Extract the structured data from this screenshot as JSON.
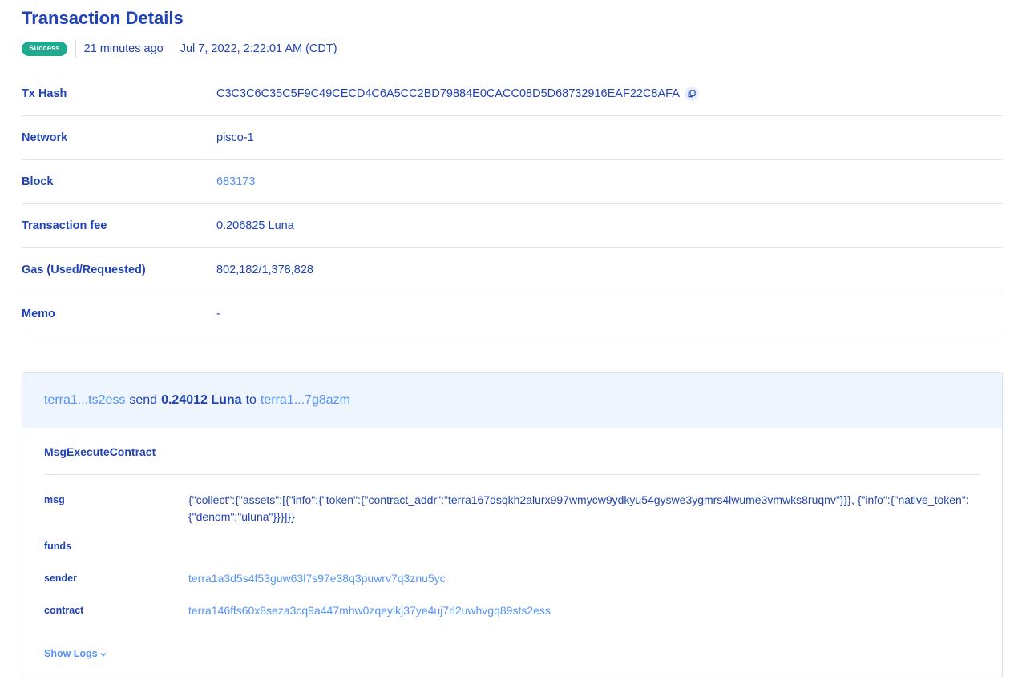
{
  "page": {
    "title": "Transaction Details"
  },
  "status": {
    "badge": "Success",
    "relative_time": "21 minutes ago",
    "timestamp": "Jul 7, 2022, 2:22:01 AM (CDT)"
  },
  "details": [
    {
      "label": "Tx Hash",
      "value": "C3C3C6C35C5F9C49CECD4C6A5CC2BD79884E0CACC08D5D68732916EAF22C8AFA"
    },
    {
      "label": "Network",
      "value": "pisco-1"
    },
    {
      "label": "Block",
      "value": "683173"
    },
    {
      "label": "Transaction fee",
      "value": "0.206825 Luna"
    },
    {
      "label": "Gas (Used/Requested)",
      "value": "802,182/1,378,828"
    },
    {
      "label": "Memo",
      "value": "-"
    }
  ],
  "message": {
    "summary": {
      "from": "terra1...ts2ess",
      "action": "send",
      "amount": "0.24012 Luna",
      "to_word": "to",
      "to": "terra1...7g8azm"
    },
    "type": "MsgExecuteContract",
    "params": [
      {
        "label": "msg",
        "value": "{\"collect\":{\"assets\":[{\"info\":{\"token\":{\"contract_addr\":\"terra167dsqkh2alurx997wmycw9ydkyu54gyswe3ygmrs4lwume3vmwks8ruqnv\"}}}, {\"info\":{\"native_token\":{\"denom\":\"uluna\"}}}]}}"
      },
      {
        "label": "funds",
        "value": ""
      },
      {
        "label": "sender",
        "value": "terra1a3d5s4f53guw63l7s97e38q3puwrv7q3znu5yc"
      },
      {
        "label": "contract",
        "value": "terra146ffs60x8seza3cq9a447mhw0zqeylkj37ye4uj7rl2uwhvgq89sts2ess"
      }
    ],
    "show_logs": "Show Logs"
  },
  "icons": {
    "copy": "copy-icon",
    "chevron": "chevron-down-icon"
  },
  "colors": {
    "primary": "#2043b5",
    "link": "#5493f7",
    "success": "#1daa8e",
    "card_header_bg": "#eff5fe"
  }
}
